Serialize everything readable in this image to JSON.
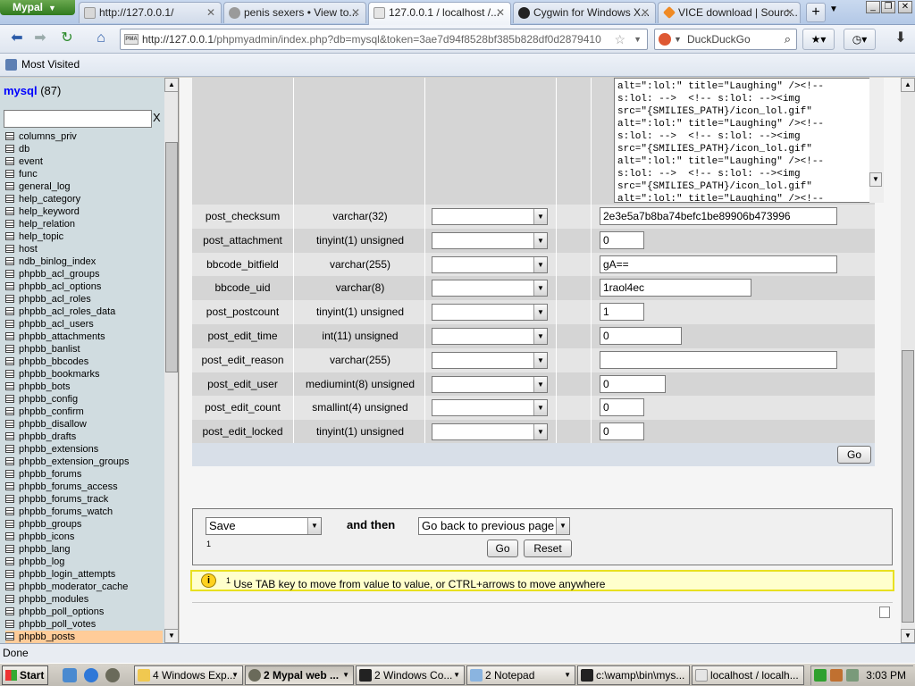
{
  "browser": {
    "app_menu": "Mypal",
    "tabs": [
      {
        "title": "http://127.0.0.1/"
      },
      {
        "title": "penis sexers • View to..."
      },
      {
        "title": "127.0.0.1 / localhost /..."
      },
      {
        "title": "Cygwin for Windows X..."
      },
      {
        "title": "VICE download | Sourc..."
      }
    ],
    "active_tab": 2,
    "url": "http://127.0.0.1/phpmyadmin/index.php?db=mysql&token=3ae7d94f8528bf385b828df0d2879410",
    "url_host": "http://127.0.0.1",
    "url_rest": "/phpmyadmin/index.php?db=mysql&token=3ae7d94f8528bf385b828df0d2879410",
    "search_engine": "DuckDuckGo",
    "bookmarks": [
      {
        "label": "Most Visited"
      }
    ],
    "status_text": "Done",
    "pma_badge": "PMA"
  },
  "sidebar": {
    "db_name": "mysql",
    "db_count": "(87)",
    "filter_value": "",
    "filter_clear": "X",
    "tables": [
      "columns_priv",
      "db",
      "event",
      "func",
      "general_log",
      "help_category",
      "help_keyword",
      "help_relation",
      "help_topic",
      "host",
      "ndb_binlog_index",
      "phpbb_acl_groups",
      "phpbb_acl_options",
      "phpbb_acl_roles",
      "phpbb_acl_roles_data",
      "phpbb_acl_users",
      "phpbb_attachments",
      "phpbb_banlist",
      "phpbb_bbcodes",
      "phpbb_bookmarks",
      "phpbb_bots",
      "phpbb_config",
      "phpbb_confirm",
      "phpbb_disallow",
      "phpbb_drafts",
      "phpbb_extensions",
      "phpbb_extension_groups",
      "phpbb_forums",
      "phpbb_forums_access",
      "phpbb_forums_track",
      "phpbb_forums_watch",
      "phpbb_groups",
      "phpbb_icons",
      "phpbb_lang",
      "phpbb_log",
      "phpbb_login_attempts",
      "phpbb_moderator_cache",
      "phpbb_modules",
      "phpbb_poll_options",
      "phpbb_poll_votes",
      "phpbb_posts"
    ],
    "selected_table": "phpbb_posts"
  },
  "editor": {
    "textarea_lines": [
      "alt=\":lol:\" title=\"Laughing\" /><!--",
      "s:lol: -->  <!-- s:lol: --><img",
      "src=\"{SMILIES_PATH}/icon_lol.gif\"",
      "alt=\":lol:\" title=\"Laughing\" /><!--",
      "s:lol: -->  <!-- s:lol: --><img",
      "src=\"{SMILIES_PATH}/icon_lol.gif\"",
      "alt=\":lol:\" title=\"Laughing\" /><!--",
      "s:lol: -->  <!-- s:lol: --><img",
      "src=\"{SMILIES_PATH}/icon_lol.gif\"",
      "alt=\":lol:\" title=\"Laughing\" /><!--",
      "s:lol: -->  <!-- s:lol: --><img",
      "src=\"{SMILIES_PATH}/icon_lol.gif\"",
      "alt=\":lol:\" title=\"Laughing\" /><!--"
    ],
    "rows": [
      {
        "name": "post_checksum",
        "type": "varchar(32)",
        "function": "",
        "value": "2e3e5a7b8ba74befc1be89906b473996"
      },
      {
        "name": "post_attachment",
        "type": "tinyint(1) unsigned",
        "function": "",
        "value": "0"
      },
      {
        "name": "bbcode_bitfield",
        "type": "varchar(255)",
        "function": "",
        "value": "gA=="
      },
      {
        "name": "bbcode_uid",
        "type": "varchar(8)",
        "function": "",
        "value": "1raol4ec"
      },
      {
        "name": "post_postcount",
        "type": "tinyint(1) unsigned",
        "function": "",
        "value": "1"
      },
      {
        "name": "post_edit_time",
        "type": "int(11) unsigned",
        "function": "",
        "value": "0"
      },
      {
        "name": "post_edit_reason",
        "type": "varchar(255)",
        "function": "",
        "value": ""
      },
      {
        "name": "post_edit_user",
        "type": "mediumint(8) unsigned",
        "function": "",
        "value": "0"
      },
      {
        "name": "post_edit_count",
        "type": "smallint(4) unsigned",
        "function": "",
        "value": "0"
      },
      {
        "name": "post_edit_locked",
        "type": "tinyint(1) unsigned",
        "function": "",
        "value": "0"
      }
    ],
    "go_label": "Go"
  },
  "action": {
    "save_option": "Save",
    "and_then": "and then",
    "then_option": "Go back to previous page",
    "footnote_mark": "1",
    "go_label": "Go",
    "reset_label": "Reset"
  },
  "notice": {
    "sup": "1",
    "text": "Use TAB key to move from value to value, or CTRL+arrows to move anywhere"
  },
  "taskbar": {
    "start_label": "Start",
    "tasks": [
      {
        "label": "4 Windows Exp..."
      },
      {
        "label": "2 Mypal web ..."
      },
      {
        "label": "2 Windows Co..."
      },
      {
        "label": "2 Notepad"
      },
      {
        "label": "c:\\wamp\\bin\\mys..."
      },
      {
        "label": "localhost / localh..."
      }
    ],
    "clock": "3:03 PM"
  }
}
